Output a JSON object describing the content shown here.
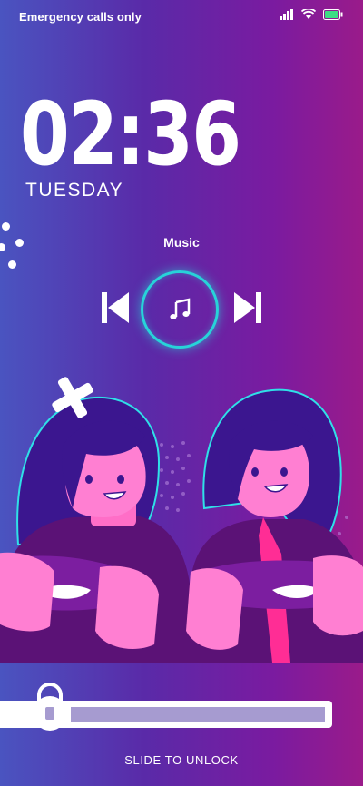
{
  "status_bar": {
    "carrier_text": "Emergency calls only",
    "icons": [
      "signal-icon",
      "wifi-icon",
      "battery-icon"
    ],
    "battery_color": "#3ddc84"
  },
  "clock": {
    "time": "02:36",
    "day": "TUESDAY"
  },
  "music": {
    "label": "Music",
    "controls": [
      "previous-icon",
      "music-note-icon",
      "next-icon"
    ],
    "accent_color": "#27d3d9"
  },
  "unlock": {
    "label": "SLIDE TO UNLOCK",
    "icon": "lock-icon",
    "progress": 0
  },
  "colors": {
    "bg_left": "#4a54c0",
    "bg_right": "#9a1b8a",
    "character_skin": "#ff7fd2",
    "character_hair": "#3b168f"
  }
}
